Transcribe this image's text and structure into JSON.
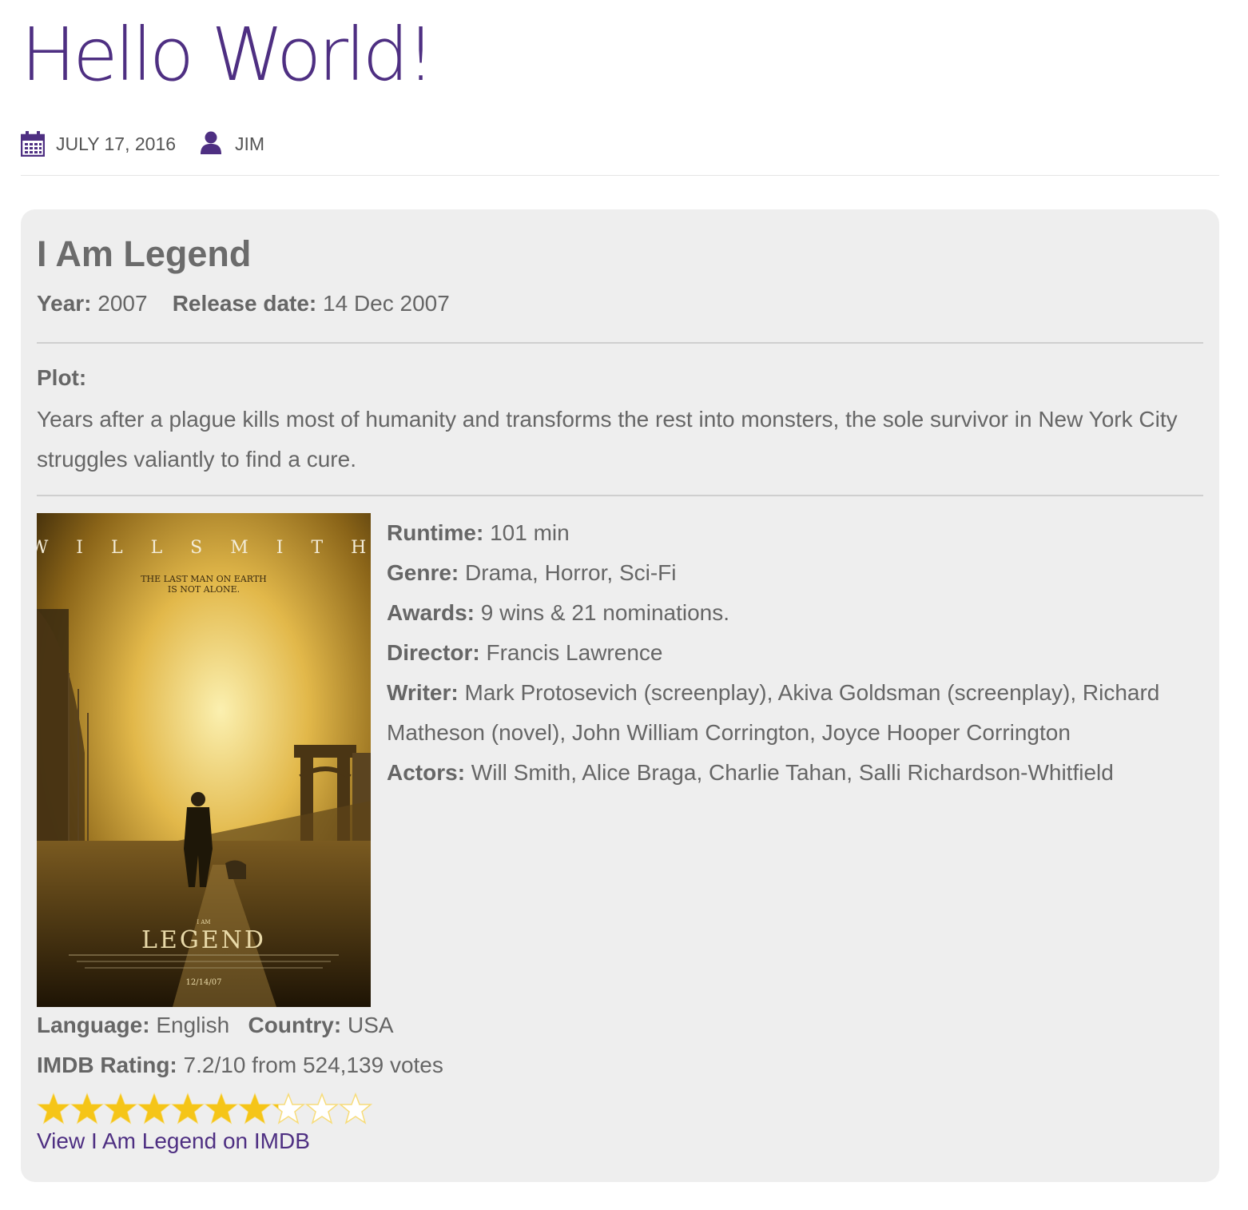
{
  "post": {
    "title": "Hello World!",
    "date": "JULY 17, 2016",
    "author": "JIM",
    "accent_color": "#4e2f82"
  },
  "movie": {
    "title": "I Am Legend",
    "year_label": "Year:",
    "year": "2007",
    "release_label": "Release date:",
    "release": "14 Dec 2007",
    "plot_label": "Plot:",
    "plot": "Years after a plague kills most of humanity and transforms the rest into monsters, the sole survivor in New York City struggles valiantly to find a cure.",
    "poster": {
      "actor_text": "W I L L   S M I T H",
      "tagline_1": "THE LAST MAN ON EARTH",
      "tagline_2": "IS NOT ALONE.",
      "small_title": "I AM",
      "big_title": "LEGEND",
      "date": "12/14/07"
    },
    "runtime_label": "Runtime:",
    "runtime": "101 min",
    "genre_label": "Genre:",
    "genre": "Drama, Horror, Sci-Fi",
    "awards_label": "Awards:",
    "awards": "9 wins & 21 nominations.",
    "director_label": "Director:",
    "director": "Francis Lawrence",
    "writer_label": "Writer:",
    "writer": "Mark Protosevich (screenplay), Akiva Goldsman (screenplay), Richard Matheson (novel), John William Corrington, Joyce Hooper Corrington",
    "actors_label": "Actors:",
    "actors": "Will Smith, Alice Braga, Charlie Tahan, Salli Richardson-Whitfield",
    "language_label": "Language:",
    "language": "English",
    "country_label": "Country:",
    "country": "USA",
    "rating_label": "IMDB Rating:",
    "rating_text": "7.2/10 from 524,139 votes",
    "rating_value": 7.2,
    "rating_max": 10,
    "star_color": "#f5c518",
    "link_text": "View I Am Legend on IMDB"
  }
}
